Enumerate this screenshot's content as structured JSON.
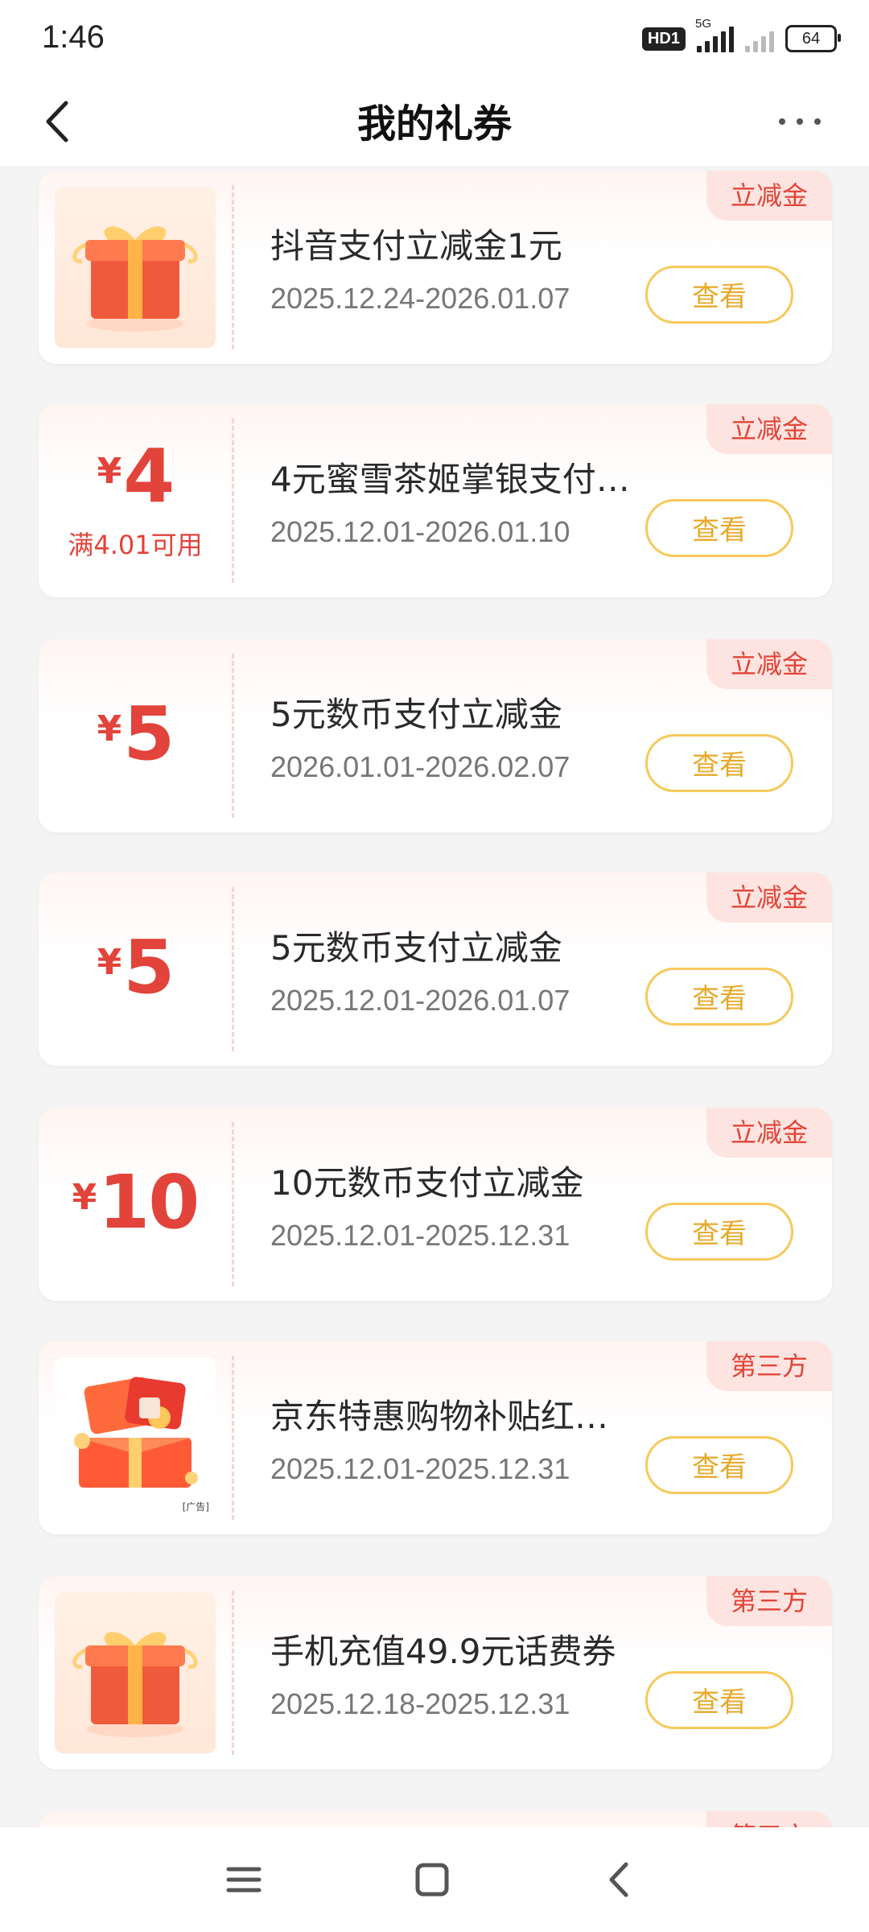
{
  "status_bar": {
    "time": "1:46",
    "hd_badge": "HD1",
    "network": "5G",
    "battery": "64"
  },
  "header": {
    "title": "我的礼券",
    "back_icon": "chevron-left-icon",
    "more_icon": "more-dots-icon"
  },
  "coupons": [
    {
      "type": "image",
      "image": "gift-box",
      "tag": "立减金",
      "name": "抖音支付立减金1元",
      "date": "2025.12.24-2026.01.07",
      "button": "查看"
    },
    {
      "type": "amount",
      "yen": "¥",
      "amount": "4",
      "condition": "满4.01可用",
      "tag": "立减金",
      "name": "4元蜜雪茶姬掌银支付…",
      "date": "2025.12.01-2026.01.10",
      "button": "查看"
    },
    {
      "type": "amount",
      "yen": "¥",
      "amount": "5",
      "tag": "立减金",
      "name": "5元数币支付立减金",
      "date": "2026.01.01-2026.02.07",
      "button": "查看"
    },
    {
      "type": "amount",
      "yen": "¥",
      "amount": "5",
      "tag": "立减金",
      "name": "5元数币支付立减金",
      "date": "2025.12.01-2026.01.07",
      "button": "查看"
    },
    {
      "type": "amount",
      "yen": "¥",
      "amount": "10",
      "tag": "立减金",
      "name": "10元数币支付立减金",
      "date": "2025.12.01-2025.12.31",
      "button": "查看"
    },
    {
      "type": "image",
      "image": "red-envelope-box",
      "ad_label": "[广告]",
      "tag": "第三方",
      "name": "京东特惠购物补贴红…",
      "date": "2025.12.01-2025.12.31",
      "button": "查看"
    },
    {
      "type": "image",
      "image": "gift-box",
      "tag": "第三方",
      "name": "手机充值49.9元话费券",
      "date": "2025.12.18-2025.12.31",
      "button": "查看"
    },
    {
      "type": "partial",
      "tag": "第三方"
    }
  ],
  "nav_bar": {
    "menu_icon": "menu-icon",
    "home_icon": "home-square-icon",
    "back_icon": "back-triangle-icon"
  },
  "colors": {
    "accent_red": "#e2433a",
    "button_gold": "#e7a92a",
    "tag_bg": "#fde4e0"
  }
}
